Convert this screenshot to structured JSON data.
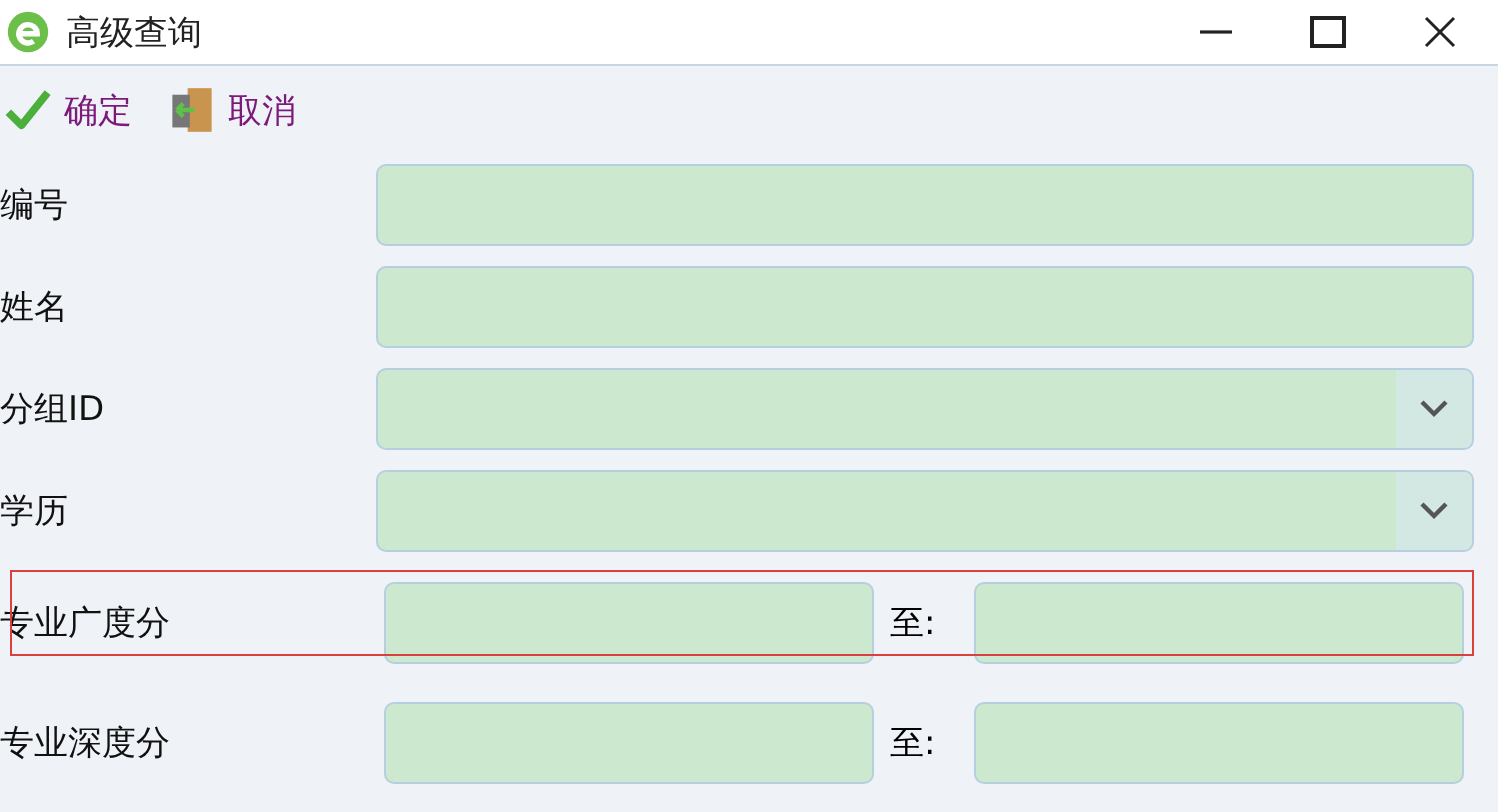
{
  "window": {
    "title": "高级查询"
  },
  "toolbar": [
    {
      "kind": "confirm",
      "label": "确定"
    },
    {
      "kind": "cancel",
      "label": "取消"
    }
  ],
  "fields": [
    {
      "kind": "text",
      "label": "编号"
    },
    {
      "kind": "text",
      "label": "姓名"
    },
    {
      "kind": "select",
      "label": "分组ID"
    },
    {
      "kind": "select",
      "label": "学历"
    },
    {
      "kind": "range",
      "label": "专业广度分",
      "separator": "至:",
      "highlighted": true
    },
    {
      "kind": "range",
      "label": "专业深度分",
      "separator": "至:",
      "highlighted": false
    }
  ]
}
